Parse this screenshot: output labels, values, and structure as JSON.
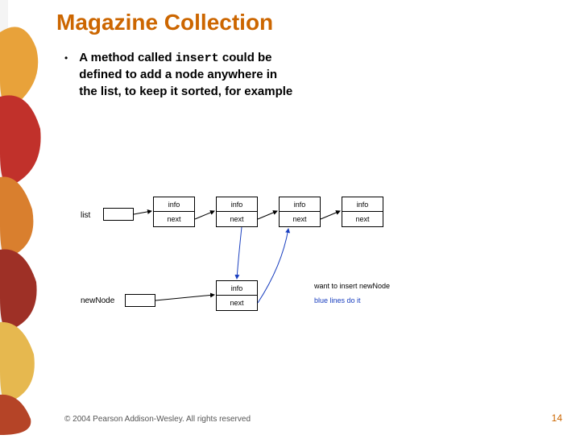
{
  "slide": {
    "title": "Magazine Collection",
    "bullet_prefix": "A method called ",
    "bullet_code": "insert",
    "bullet_suffix": " could be defined to add a node anywhere in the list, to keep it sorted, for example",
    "footer": "© 2004 Pearson Addison-Wesley. All rights reserved",
    "page_number": "14"
  },
  "diagram": {
    "list_label": "list",
    "newnode_label": "newNode",
    "node_top_label": "info",
    "node_bottom_label": "next",
    "annotation1": "want to insert newNode",
    "annotation2": "blue lines do it",
    "annotation2_color": "#1a3fbf"
  }
}
